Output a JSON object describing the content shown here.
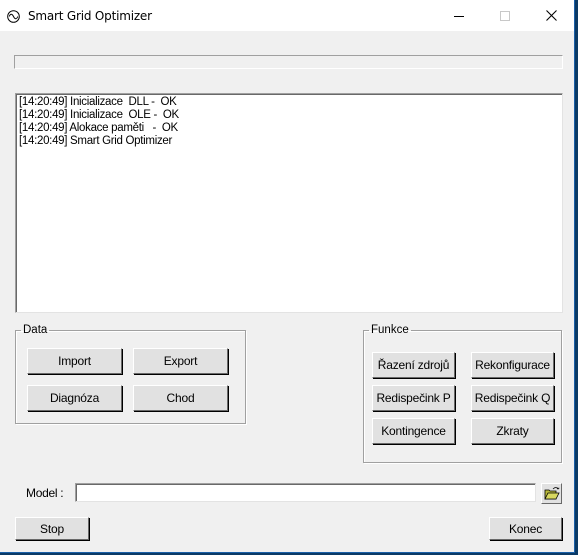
{
  "window": {
    "title": "Smart Grid Optimizer",
    "app_icon": "sine-wave-icon",
    "controls": {
      "minimize": "minimize-icon",
      "maximize": "maximize-icon",
      "close": "close-icon"
    }
  },
  "progress": {
    "value_percent": 0
  },
  "log": {
    "lines": [
      "[14:20:49] Inicializace  DLL -  OK",
      "[14:20:49] Inicializace  OLE -  OK",
      "[14:20:49] Alokace paměti   -  OK",
      "[14:20:49] Smart Grid Optimizer"
    ]
  },
  "data_group": {
    "legend": "Data",
    "buttons": {
      "import": "Import",
      "export": "Export",
      "diagnoza": "Diagnóza",
      "chod": "Chod"
    }
  },
  "func_group": {
    "legend": "Funkce",
    "buttons": {
      "razeni": "Řazení zdrojů",
      "rekonfigurace": "Rekonfigurace",
      "redispecink_p": "Redispečink P",
      "redispecink_q": "Redispečink Q",
      "kontingence": "Kontingence",
      "zkraty": "Zkraty"
    }
  },
  "model": {
    "label": "Model :",
    "value": "",
    "browse_icon": "open-folder-icon"
  },
  "footer": {
    "stop": "Stop",
    "konec": "Konec"
  }
}
